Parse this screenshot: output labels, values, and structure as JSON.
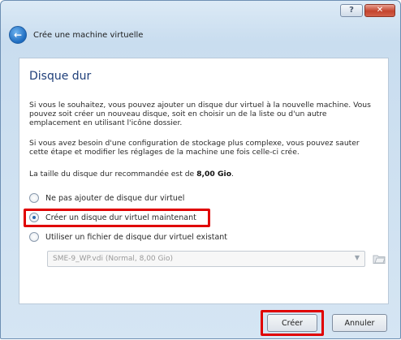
{
  "window": {
    "title": "Crée une machine virtuelle",
    "help_label": "?",
    "close_label": "✕",
    "back_label": "←"
  },
  "page": {
    "title": "Disque dur",
    "paragraph1": "Si vous le souhaitez, vous pouvez ajouter un disque dur virtuel à la nouvelle machine. Vous pouvez soit créer un nouveau disque, soit en choisir un de la liste ou d'un autre emplacement en utilisant l'icône dossier.",
    "paragraph2": "Si vous avez besoin d'une configuration de stockage plus complexe, vous pouvez sauter cette étape et modifier les réglages de la machine une fois celle-ci crée.",
    "recommended_prefix": "La taille du disque dur recommandée est de ",
    "recommended_size": "8,00 Gio",
    "recommended_suffix": "."
  },
  "options": [
    {
      "label": "Ne pas ajouter de disque dur virtuel",
      "checked": false
    },
    {
      "label": "Créer un disque dur virtuel maintenant",
      "checked": true
    },
    {
      "label": "Utiliser un fichier de disque dur virtuel existant",
      "checked": false
    }
  ],
  "existing_file": {
    "value": "SME-9_WP.vdi (Normal, 8,00 Gio)",
    "arrow": "▼",
    "folder_icon": "folder-icon"
  },
  "buttons": {
    "create": "Créer",
    "cancel": "Annuler"
  },
  "colors": {
    "highlight": "#e00000",
    "title_blue": "#1f3f7a"
  }
}
